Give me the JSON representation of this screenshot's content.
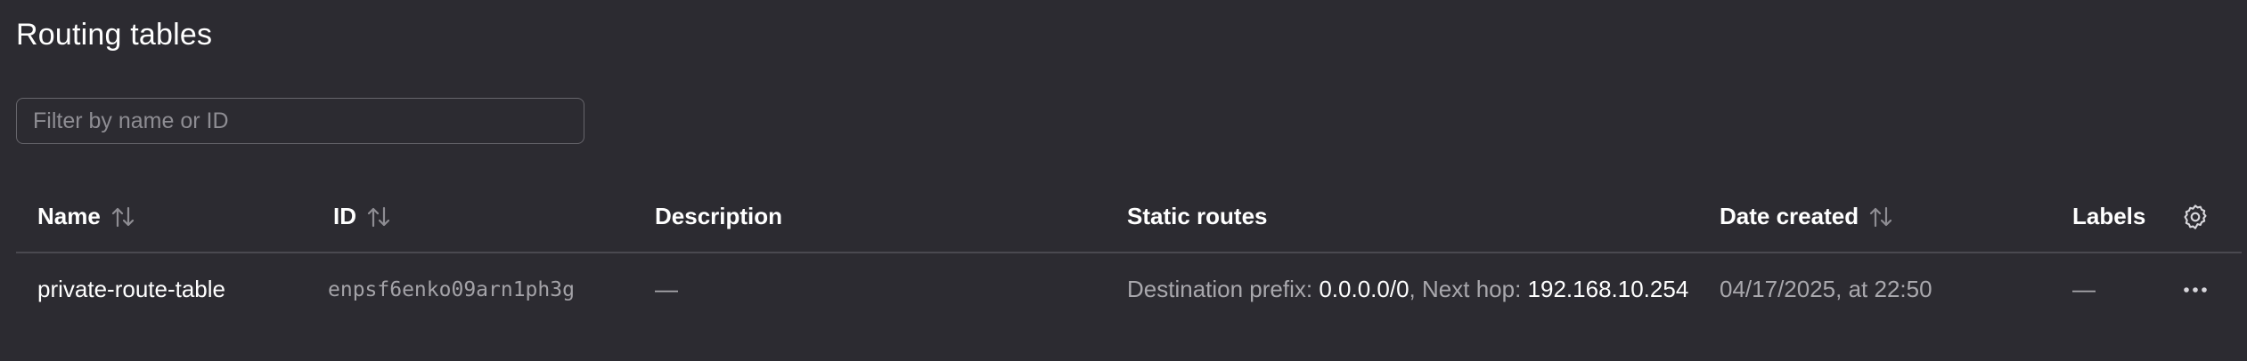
{
  "page": {
    "title": "Routing tables"
  },
  "filter": {
    "placeholder": "Filter by name or ID",
    "value": ""
  },
  "table": {
    "columns": [
      {
        "label": "Name",
        "sortable": true
      },
      {
        "label": "ID",
        "sortable": true
      },
      {
        "label": "Description",
        "sortable": false
      },
      {
        "label": "Static routes",
        "sortable": false
      },
      {
        "label": "Date created",
        "sortable": true
      },
      {
        "label": "Labels",
        "sortable": false
      }
    ],
    "rows": [
      {
        "name": "private-route-table",
        "id": "enpsf6enko09arn1ph3g",
        "description": "—",
        "static_routes": {
          "prefix_label": "Destination prefix:",
          "prefix_value": "0.0.0.0/0",
          "separator": ",",
          "hop_label": "Next hop:",
          "hop_value": "192.168.10.254"
        },
        "date_created": "04/17/2025, at 22:50",
        "labels": "—"
      }
    ]
  },
  "icons": {
    "sort": "sort-arrows-icon",
    "settings": "gear-icon",
    "row_actions": "more-horizontal-icon"
  },
  "colors": {
    "background": "#2c2b31",
    "text": "#ffffff",
    "muted_text": "#a9a8ad",
    "divider": "#4a4950"
  }
}
